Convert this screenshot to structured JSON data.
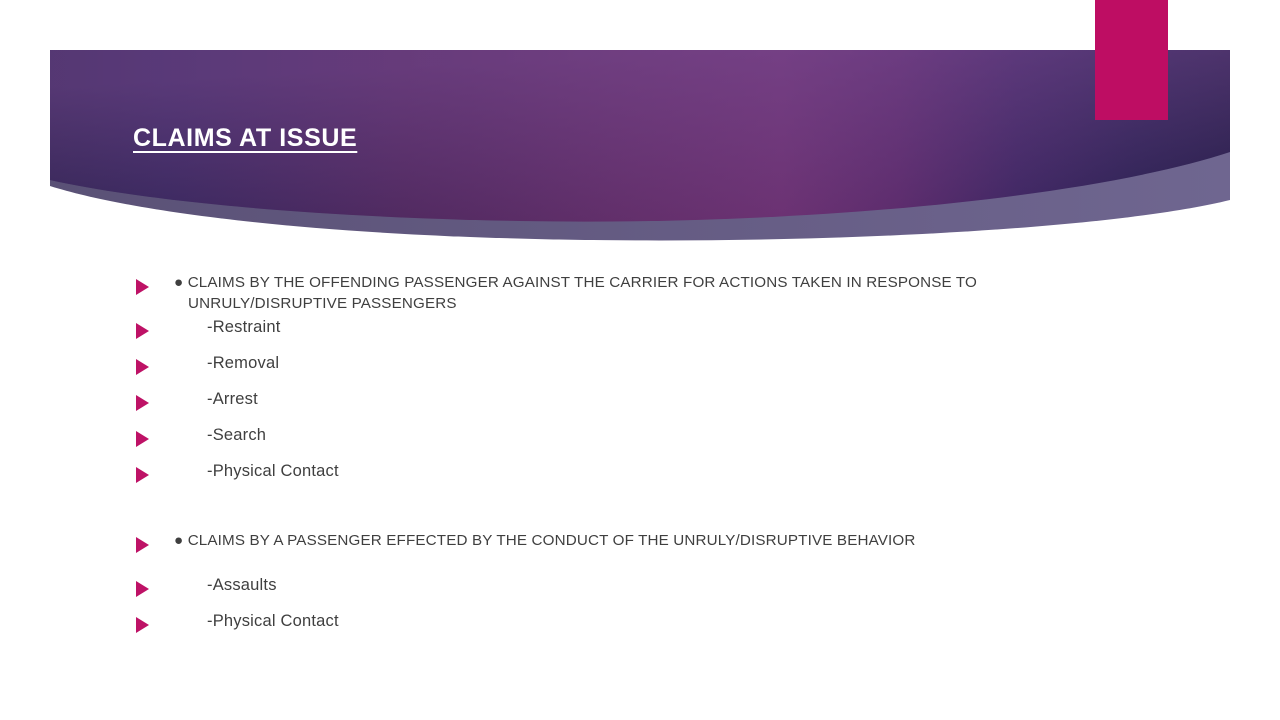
{
  "slide": {
    "title": "CLAIMS AT ISSUE",
    "background_color": "#ffffff",
    "accent_color": "#be0d63",
    "banner_dark_color": "#2a2150",
    "banner_mid_color": "#5c2b63",
    "banner_light_swoosh_color": "#6b6189",
    "title_color": "#ffffff",
    "body_text_color": "#3f3f3f",
    "marker_color": "#be1266"
  },
  "body": {
    "rows": [
      {
        "level": 1,
        "marker": "triangle-right-icon",
        "text": "● CLAIMS BY THE OFFENDING PASSENGER AGAINST THE CARRIER FOR ACTIONS TAKEN IN RESPONSE TO UNRULY/DISRUPTIVE PASSENGERS"
      },
      {
        "level": 2,
        "marker": "triangle-right-icon",
        "text": "-Restraint"
      },
      {
        "level": 2,
        "marker": "triangle-right-icon",
        "text": "-Removal"
      },
      {
        "level": 2,
        "marker": "triangle-right-icon",
        "text": "-Arrest"
      },
      {
        "level": 2,
        "marker": "triangle-right-icon",
        "text": "-Search"
      },
      {
        "level": 2,
        "marker": "triangle-right-icon",
        "text": "-Physical Contact"
      },
      {
        "level": 1,
        "marker": "triangle-right-icon",
        "text": "● CLAIMS BY A PASSENGER EFFECTED BY THE CONDUCT OF THE UNRULY/DISRUPTIVE BEHAVIOR"
      },
      {
        "level": 2,
        "marker": "triangle-right-icon",
        "text": "-Assaults"
      },
      {
        "level": 2,
        "marker": "triangle-right-icon",
        "text": "-Physical Contact"
      }
    ]
  }
}
